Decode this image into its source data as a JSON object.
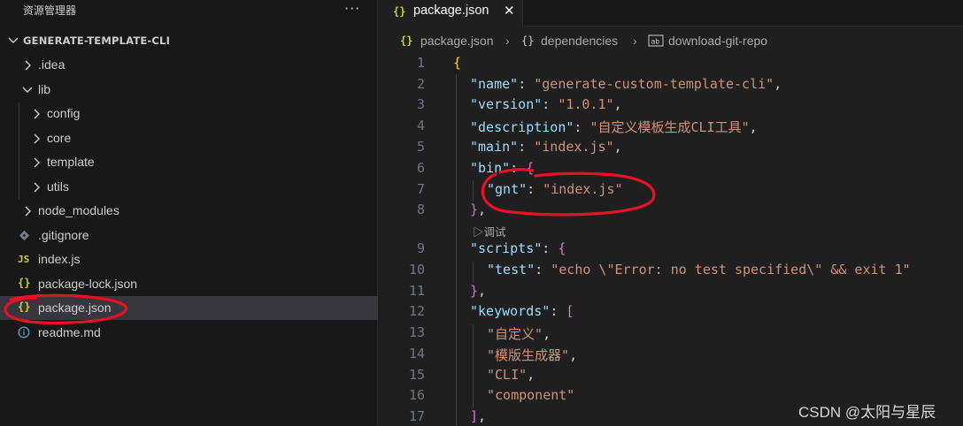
{
  "sidebar": {
    "title": "资源管理器",
    "more_label": "···",
    "project_name": "GENERATE-TEMPLATE-CLI",
    "items": [
      {
        "label": ".idea",
        "type": "folder",
        "expanded": false,
        "depth": 0
      },
      {
        "label": "lib",
        "type": "folder",
        "expanded": true,
        "depth": 0
      },
      {
        "label": "config",
        "type": "folder",
        "expanded": false,
        "depth": 1
      },
      {
        "label": "core",
        "type": "folder",
        "expanded": false,
        "depth": 1
      },
      {
        "label": "template",
        "type": "folder",
        "expanded": false,
        "depth": 1
      },
      {
        "label": "utils",
        "type": "folder",
        "expanded": false,
        "depth": 1
      },
      {
        "label": "node_modules",
        "type": "folder",
        "expanded": false,
        "depth": 0
      },
      {
        "label": ".gitignore",
        "type": "git-file",
        "icon": "git-icon",
        "depth": 0
      },
      {
        "label": "index.js",
        "type": "js-file",
        "icon_text": "JS",
        "depth": 0
      },
      {
        "label": "package-lock.json",
        "type": "json-file",
        "icon_text": "{}",
        "depth": 0
      },
      {
        "label": "package.json",
        "type": "json-file",
        "icon_text": "{}",
        "depth": 0,
        "selected": true
      },
      {
        "label": "readme.md",
        "type": "info-file",
        "icon": "info-icon",
        "depth": 0
      }
    ]
  },
  "editor": {
    "tab": {
      "icon_text": "{}",
      "label": "package.json",
      "close_label": "✕"
    },
    "breadcrumb": {
      "icon_text_1": "{}",
      "item_1": "package.json",
      "icon_text_2": "{}",
      "item_2": "dependencies",
      "item_3": "download-git-repo",
      "separator": "›"
    },
    "codelens": "▷调试",
    "line_numbers": [
      "1",
      "2",
      "3",
      "4",
      "5",
      "6",
      "7",
      "8",
      "9",
      "10",
      "11",
      "12",
      "13",
      "14",
      "15",
      "16",
      "17"
    ],
    "code": {
      "l1_brace": "{",
      "l2_key": "\"name\"",
      "l2_val": "\"generate-custom-template-cli\"",
      "l3_key": "\"version\"",
      "l3_val": "\"1.0.1\"",
      "l4_key": "\"description\"",
      "l4_val": "\"自定义模板生成CLI工具\"",
      "l5_key": "\"main\"",
      "l5_val": "\"index.js\"",
      "l6_key": "\"bin\"",
      "l6_brace": "{",
      "l7_key": "\"gnt\"",
      "l7_val": "\"index.js\"",
      "l8_close": "}",
      "l9_key": "\"scripts\"",
      "l9_brace": "{",
      "l10_key": "\"test\"",
      "l10_val": "\"echo \\\"Error: no test specified\\\" && exit 1\"",
      "l11_close": "}",
      "l12_key": "\"keywords\"",
      "l12_bracket": "[",
      "l13_val": "\"自定义\"",
      "l14_val": "\"模版生成器\"",
      "l15_val": "\"CLI\"",
      "l16_val": "\"component\"",
      "l17_close": "]"
    }
  },
  "watermark": "CSDN @太阳与星辰",
  "colors": {
    "json_icon": "#cbcb41",
    "js_icon": "#cbcb41",
    "git_icon": "#6d8086",
    "info_icon": "#519aba",
    "key": "#9cdcfe",
    "string": "#ce9178",
    "bracket_level1": "#ffd700",
    "bracket_level2": "#da70d6",
    "annotation": "#e81123"
  }
}
